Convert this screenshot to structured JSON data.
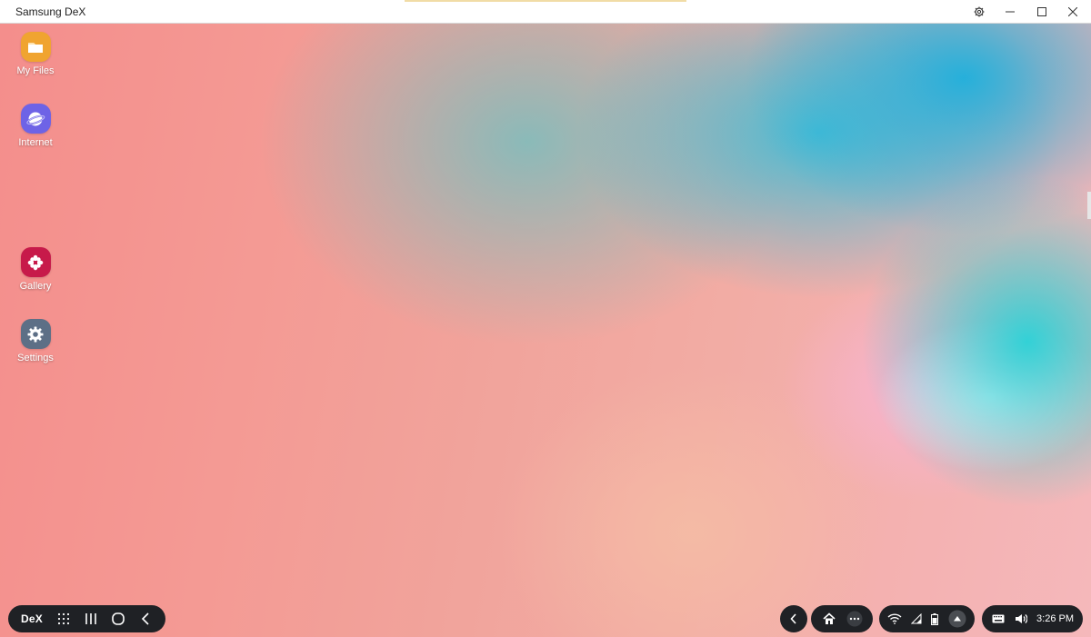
{
  "window": {
    "title": "Samsung DeX",
    "controls": [
      "settings-icon",
      "minimize-icon",
      "maximize-icon",
      "close-icon"
    ]
  },
  "desktop": {
    "icons": [
      {
        "label": "My Files",
        "icon": "folder-icon",
        "color": "#f0a430"
      },
      {
        "label": "Internet",
        "icon": "internet-planet-icon",
        "color": "#6e63e6"
      },
      {
        "label": "Gallery",
        "icon": "gallery-flower-icon",
        "color": "#c71a4a"
      },
      {
        "label": "Settings",
        "icon": "gear-icon",
        "color": "#5d6f86"
      }
    ]
  },
  "taskbar": {
    "dex_label": "DeX",
    "left_buttons": [
      "apps-grid-icon",
      "recents-icon",
      "home-circle-icon",
      "back-icon"
    ],
    "center_buttons": [
      "collapse-back-icon",
      "home-icon",
      "more-dots-icon"
    ],
    "status_icons": [
      "wifi-icon",
      "signal-icon",
      "battery-icon",
      "notifications-up-icon"
    ],
    "tray_icons": [
      "keyboard-icon",
      "volume-icon"
    ],
    "clock": "3:26 PM"
  }
}
